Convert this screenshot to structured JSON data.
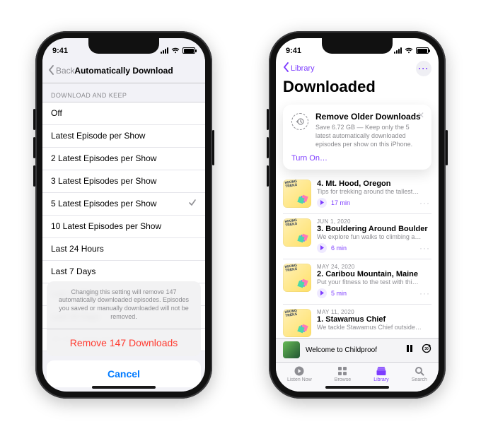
{
  "status": {
    "time": "9:41"
  },
  "left": {
    "back": "Back",
    "title": "Automatically Download",
    "section": "DOWNLOAD AND KEEP",
    "options": [
      "Off",
      "Latest Episode per Show",
      "2 Latest Episodes per Show",
      "3 Latest Episodes per Show",
      "5 Latest Episodes per Show",
      "10 Latest Episodes per Show",
      "Last 24 Hours",
      "Last 7 Days",
      "Last 14 Days",
      "Last 30 Days",
      "All New Episodes"
    ],
    "selected_index": 4,
    "sheet": {
      "message": "Changing this setting will remove 147 automatically downloaded episodes. Episodes you saved or manually downloaded will not be removed.",
      "destructive": "Remove 147 Downloads",
      "cancel": "Cancel"
    }
  },
  "right": {
    "back": "Library",
    "title": "Downloaded",
    "tip": {
      "title": "Remove Older Downloads",
      "body": "Save 6.72 GB — Keep only the 5 latest automatically downloaded episodes per show on this iPhone.",
      "action": "Turn On…"
    },
    "episodes": [
      {
        "date": "",
        "title": "4. Mt. Hood, Oregon",
        "sub": "Tips for trekking around the tallest…",
        "dur": "17 min"
      },
      {
        "date": "JUN 1, 2020",
        "title": "3. Bouldering Around Boulder",
        "sub": "We explore fun walks to climbing a…",
        "dur": "6 min"
      },
      {
        "date": "MAY 24, 2020",
        "title": "2. Caribou Mountain, Maine",
        "sub": "Put your fitness to the test with thi…",
        "dur": "5 min"
      },
      {
        "date": "MAY 11, 2020",
        "title": "1. Stawamus Chief",
        "sub": "We tackle Stawamus Chief outside…",
        "dur": ""
      }
    ],
    "now_playing": "Welcome to Childproof",
    "tabs": {
      "listen": "Listen Now",
      "browse": "Browse",
      "library": "Library",
      "search": "Search"
    }
  }
}
